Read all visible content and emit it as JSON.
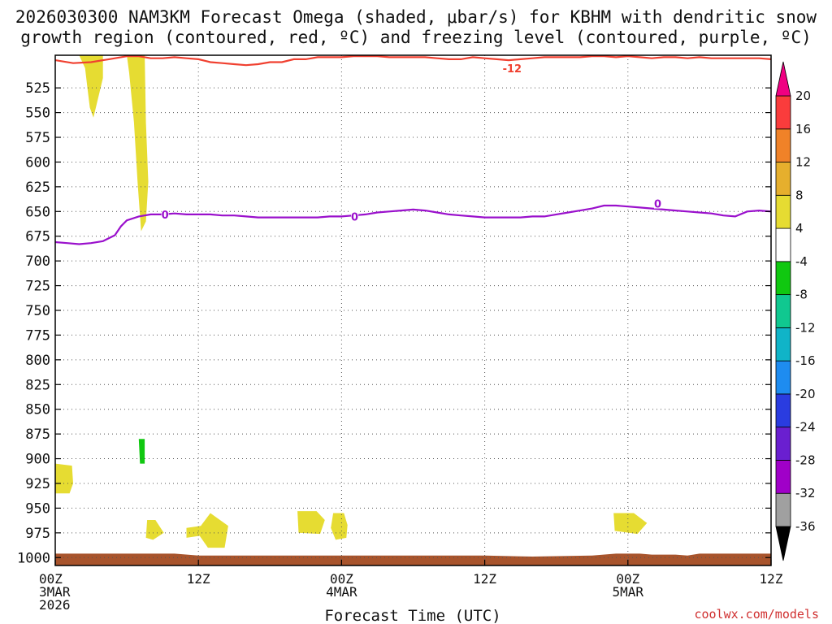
{
  "chart_data": {
    "type": "heatmap",
    "title_line1": "2026030300 NAM3KM Forecast Omega (shaded, μbar/s) for KBHM with dendritic snow",
    "title_line2": "growth region (contoured, red, ºC) and freezing level (contoured, purple, ºC)",
    "xlabel": "Forecast Time (UTC)",
    "credit": "coolwx.com/models",
    "y_axis": {
      "reversed": true,
      "ylim": [
        1008,
        492
      ],
      "ticks": [
        525,
        550,
        575,
        600,
        625,
        650,
        675,
        700,
        725,
        750,
        775,
        800,
        825,
        850,
        875,
        900,
        925,
        950,
        975,
        1000
      ]
    },
    "x_axis": {
      "xlim_hours": [
        0,
        60
      ],
      "ticks": [
        {
          "hour": 0,
          "lines": [
            "00Z",
            "3MAR",
            "2026"
          ]
        },
        {
          "hour": 12,
          "lines": [
            "12Z"
          ]
        },
        {
          "hour": 24,
          "lines": [
            "00Z",
            "4MAR"
          ]
        },
        {
          "hour": 36,
          "lines": [
            "12Z"
          ]
        },
        {
          "hour": 48,
          "lines": [
            "00Z",
            "5MAR"
          ]
        },
        {
          "hour": 60,
          "lines": [
            "12Z"
          ]
        }
      ]
    },
    "grid": true,
    "colorbar": {
      "labels": [
        "-36",
        "-32",
        "-28",
        "-24",
        "-20",
        "-16",
        "-12",
        "-8",
        "-4",
        "4",
        "8",
        "12",
        "16",
        "20"
      ],
      "colors": [
        "#000000",
        "#a0a0a0",
        "#a000c8",
        "#6a1fd0",
        "#2a3ce0",
        "#1e8cf0",
        "#10b4c8",
        "#10c890",
        "#10c810",
        "#ffffff",
        "#e6dc32",
        "#e6af2d",
        "#f08228",
        "#fa3c3c",
        "#f00082"
      ]
    },
    "contours": [
      {
        "label": "-12",
        "color": "#f04030",
        "points": [
          [
            0,
            497
          ],
          [
            1.5,
            500
          ],
          [
            3,
            499
          ],
          [
            4.5,
            496
          ],
          [
            6,
            493
          ],
          [
            7,
            493
          ],
          [
            8,
            495
          ],
          [
            9,
            495
          ],
          [
            10,
            494
          ],
          [
            11,
            495
          ],
          [
            12,
            496
          ],
          [
            13,
            499
          ],
          [
            14,
            500
          ],
          [
            15,
            501
          ],
          [
            16,
            502
          ],
          [
            17,
            501
          ],
          [
            18,
            499
          ],
          [
            19,
            499
          ],
          [
            20,
            496
          ],
          [
            21,
            496
          ],
          [
            22,
            494
          ],
          [
            23,
            494
          ],
          [
            24,
            494
          ],
          [
            25,
            493
          ],
          [
            26,
            493
          ],
          [
            27,
            493
          ],
          [
            28,
            494
          ],
          [
            29,
            494
          ],
          [
            30,
            494
          ],
          [
            31,
            494
          ],
          [
            32,
            495
          ],
          [
            33,
            496
          ],
          [
            34,
            496
          ],
          [
            35,
            494
          ],
          [
            36,
            495
          ],
          [
            37,
            496
          ],
          [
            38,
            497
          ],
          [
            39,
            496
          ],
          [
            40,
            495
          ],
          [
            41,
            494
          ],
          [
            42,
            494
          ],
          [
            43,
            494
          ],
          [
            44,
            494
          ],
          [
            45,
            493
          ],
          [
            46,
            493
          ],
          [
            47,
            494
          ],
          [
            48,
            493
          ],
          [
            49,
            494
          ],
          [
            50,
            495
          ],
          [
            51,
            494
          ],
          [
            52,
            494
          ],
          [
            53,
            495
          ],
          [
            54,
            494
          ],
          [
            55,
            495
          ],
          [
            56,
            495
          ],
          [
            57,
            495
          ],
          [
            58,
            495
          ],
          [
            59,
            495
          ],
          [
            60,
            496
          ]
        ]
      },
      {
        "label": "0",
        "color": "#9a10cc",
        "points": [
          [
            0,
            681
          ],
          [
            1,
            682
          ],
          [
            2,
            683
          ],
          [
            3,
            682
          ],
          [
            4,
            680
          ],
          [
            5,
            674
          ],
          [
            5.5,
            665
          ],
          [
            6,
            659
          ],
          [
            7,
            655
          ],
          [
            8,
            653
          ],
          [
            9,
            653
          ],
          [
            10,
            652
          ],
          [
            11,
            653
          ],
          [
            12,
            653
          ],
          [
            13,
            653
          ],
          [
            14,
            654
          ],
          [
            15,
            654
          ],
          [
            16,
            655
          ],
          [
            17,
            656
          ],
          [
            18,
            656
          ],
          [
            19,
            656
          ],
          [
            20,
            656
          ],
          [
            21,
            656
          ],
          [
            22,
            656
          ],
          [
            23,
            655
          ],
          [
            24,
            655
          ],
          [
            25,
            654
          ],
          [
            26,
            653
          ],
          [
            27,
            651
          ],
          [
            28,
            650
          ],
          [
            29,
            649
          ],
          [
            30,
            648
          ],
          [
            31,
            649
          ],
          [
            32,
            651
          ],
          [
            33,
            653
          ],
          [
            34,
            654
          ],
          [
            35,
            655
          ],
          [
            36,
            656
          ],
          [
            37,
            656
          ],
          [
            38,
            656
          ],
          [
            39,
            656
          ],
          [
            40,
            655
          ],
          [
            41,
            655
          ],
          [
            42,
            653
          ],
          [
            43,
            651
          ],
          [
            44,
            649
          ],
          [
            45,
            647
          ],
          [
            46,
            644
          ],
          [
            47,
            644
          ],
          [
            48,
            645
          ],
          [
            49,
            646
          ],
          [
            50,
            647
          ],
          [
            51,
            648
          ],
          [
            52,
            649
          ],
          [
            53,
            650
          ],
          [
            54,
            651
          ],
          [
            55,
            652
          ],
          [
            56,
            654
          ],
          [
            57,
            655
          ],
          [
            58,
            650
          ],
          [
            59,
            649
          ],
          [
            60,
            650
          ]
        ]
      }
    ],
    "shaded_regions": [
      {
        "category": "4",
        "points": [
          [
            2,
            492
          ],
          [
            4,
            492
          ],
          [
            4,
            515
          ],
          [
            3.6,
            535
          ],
          [
            3.2,
            555
          ],
          [
            2.9,
            545
          ],
          [
            2.7,
            525
          ],
          [
            2.5,
            505
          ]
        ]
      },
      {
        "category": "4",
        "points": [
          [
            6,
            492
          ],
          [
            7.5,
            492
          ],
          [
            7.6,
            560
          ],
          [
            7.8,
            620
          ],
          [
            7.6,
            660
          ],
          [
            7.2,
            670
          ],
          [
            6.9,
            620
          ],
          [
            6.6,
            560
          ],
          [
            6.2,
            510
          ]
        ]
      },
      {
        "category": "-4",
        "points": [
          [
            0,
            648
          ],
          [
            1.8,
            648
          ],
          [
            2.5,
            700
          ],
          [
            2.7,
            745
          ],
          [
            2.5,
            790
          ],
          [
            2.2,
            803
          ],
          [
            1,
            795
          ],
          [
            0,
            785
          ]
        ]
      },
      {
        "category": "-4",
        "points": [
          [
            3.5,
            777
          ],
          [
            4.1,
            777
          ],
          [
            4.4,
            795
          ],
          [
            4.2,
            830
          ],
          [
            4.0,
            870
          ],
          [
            3.8,
            868
          ],
          [
            3.7,
            830
          ],
          [
            3.4,
            795
          ]
        ]
      },
      {
        "category": "-4",
        "points": [
          [
            6.3,
            835
          ],
          [
            7.4,
            833
          ],
          [
            7.9,
            862
          ],
          [
            8.1,
            905
          ],
          [
            7.8,
            933
          ],
          [
            7.4,
            940
          ],
          [
            6.9,
            920
          ],
          [
            6.6,
            885
          ],
          [
            6.4,
            855
          ]
        ]
      },
      {
        "category": "-4",
        "points": [
          [
            10.8,
            863
          ],
          [
            11.8,
            877
          ],
          [
            11.6,
            910
          ],
          [
            11.3,
            922
          ],
          [
            10.8,
            920
          ],
          [
            10.2,
            905
          ],
          [
            10.3,
            890
          ]
        ]
      },
      {
        "category": "-8",
        "points": [
          [
            7.0,
            880
          ],
          [
            7.5,
            880
          ],
          [
            7.5,
            905
          ],
          [
            7.1,
            905
          ]
        ]
      },
      {
        "category": "4",
        "points": [
          [
            0,
            905
          ],
          [
            1.4,
            907
          ],
          [
            1.5,
            925
          ],
          [
            1.2,
            935
          ],
          [
            0,
            935
          ]
        ]
      },
      {
        "category": "4",
        "points": [
          [
            7.7,
            962
          ],
          [
            8.4,
            962
          ],
          [
            9.1,
            975
          ],
          [
            8.2,
            982
          ],
          [
            7.6,
            980
          ]
        ]
      },
      {
        "category": "4",
        "points": [
          [
            11,
            970
          ],
          [
            12.2,
            968
          ],
          [
            13,
            955
          ],
          [
            14.5,
            968
          ],
          [
            14.2,
            990
          ],
          [
            12.8,
            990
          ],
          [
            12.1,
            978
          ],
          [
            11,
            980
          ]
        ]
      },
      {
        "category": "4",
        "points": [
          [
            20.3,
            953
          ],
          [
            21.9,
            953
          ],
          [
            22.6,
            962
          ],
          [
            22.2,
            976
          ],
          [
            20.4,
            975
          ]
        ]
      },
      {
        "category": "4",
        "points": [
          [
            23.3,
            955
          ],
          [
            24.2,
            955
          ],
          [
            24.5,
            967
          ],
          [
            24.4,
            980
          ],
          [
            23.5,
            982
          ],
          [
            23.1,
            970
          ]
        ]
      },
      {
        "category": "4",
        "points": [
          [
            46.8,
            955
          ],
          [
            48.5,
            955
          ],
          [
            49.6,
            965
          ],
          [
            48.8,
            976
          ],
          [
            46.9,
            973
          ]
        ]
      }
    ],
    "surface": {
      "color": "#a8542c",
      "points": [
        [
          0,
          996
        ],
        [
          10,
          996
        ],
        [
          12,
          998
        ],
        [
          15,
          998
        ],
        [
          26,
          998
        ],
        [
          30,
          998
        ],
        [
          36,
          998
        ],
        [
          40,
          999
        ],
        [
          45,
          998
        ],
        [
          47,
          996
        ],
        [
          49,
          996
        ],
        [
          50,
          997
        ],
        [
          52,
          997
        ],
        [
          53,
          998
        ],
        [
          54,
          996
        ],
        [
          60,
          996
        ]
      ]
    },
    "contour_labels": [
      {
        "text": "-12",
        "x": 38.3,
        "y": 505
      },
      {
        "text": "0",
        "x": 9.2,
        "y": 653
      },
      {
        "text": "0",
        "x": 25.1,
        "y": 655
      },
      {
        "text": "0",
        "x": 50.5,
        "y": 642
      }
    ]
  }
}
